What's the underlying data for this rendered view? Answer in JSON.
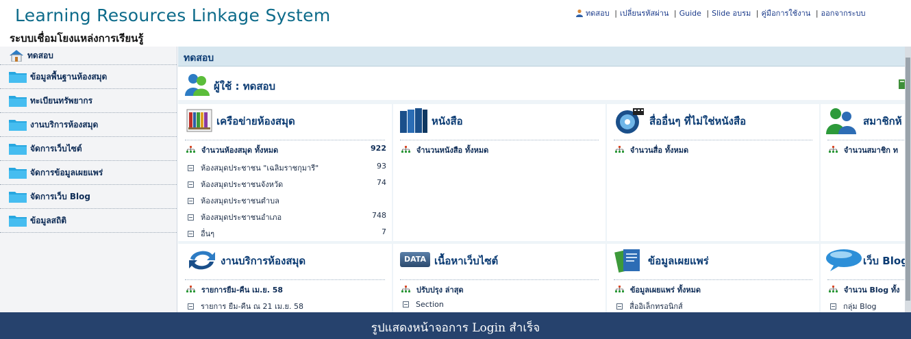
{
  "header": {
    "title": "Learning Resources Linkage System",
    "subtitle": "ระบบเชื่อมโยงแหล่งการเรียนรู้",
    "links": {
      "user": "ทดสอบ",
      "change_password": "เปลี่ยนรหัสผ่าน",
      "guide": "Guide",
      "slide": "Slide อบรม",
      "manual": "คู่มือการใช้งาน",
      "logout": "ออกจากระบบ"
    }
  },
  "sidebar": {
    "items": [
      {
        "label": "ทดสอบ",
        "icon": "home-icon"
      },
      {
        "label": "ข้อมูลพื้นฐานห้องสมุด",
        "icon": "folder-icon"
      },
      {
        "label": "ทะเบียนทรัพยากร",
        "icon": "folder-icon"
      },
      {
        "label": "งานบริการห้องสมุด",
        "icon": "folder-icon"
      },
      {
        "label": "จัดการเว็บไซต์",
        "icon": "folder-icon"
      },
      {
        "label": "จัดการข้อมูลเผยแพร่",
        "icon": "folder-icon"
      },
      {
        "label": "จัดการเว็บ Blog",
        "icon": "folder-icon"
      },
      {
        "label": "ข้อมูลสถิติ",
        "icon": "folder-icon"
      }
    ]
  },
  "main": {
    "title": "ทดสอบ",
    "user_label": "ผู้ใช้ : ทดสอบ",
    "panels": {
      "library": {
        "title": "เครือข่ายห้องสมุด",
        "total_label": "จำนวนห้องสมุด ทั้งหมด",
        "total_value": "922",
        "rows": [
          {
            "label": "ห้องสมุดประชาชน \"เฉลิมราชกุมารี\"",
            "value": "93"
          },
          {
            "label": "ห้องสมุดประชาชนจังหวัด",
            "value": "74"
          },
          {
            "label": "ห้องสมุดประชาชนตำบล",
            "value": ""
          },
          {
            "label": "ห้องสมุดประชาชนอำเภอ",
            "value": "748"
          },
          {
            "label": "อื่นๆ",
            "value": "7"
          }
        ]
      },
      "books": {
        "title": "หนังสือ",
        "total_label": "จำนวนหนังสือ ทั้งหมด"
      },
      "media": {
        "title": "สื่ออื่นๆ ที่ไม่ใช่หนังสือ",
        "total_label": "จำนวนสื่อ ทั้งหมด"
      },
      "members": {
        "title": "สมาชิกห้",
        "total_label": "จำนวนสมาชิก ท"
      },
      "services": {
        "title": "งานบริการห้องสมุด",
        "total_label": "รายการยืม-คืน เม.ย. 58",
        "rows": [
          {
            "label": "รายการ ยืม-คืน ณ 21 เม.ย. 58"
          }
        ]
      },
      "website": {
        "title": "เนื้อหาเว็บไซต์",
        "badge": "DATA",
        "total_label": "ปรับปรุง ล่าสุด",
        "rows": [
          {
            "label": "Section"
          }
        ]
      },
      "publish": {
        "title": "ข้อมูลเผยแพร่",
        "total_label": "ข้อมูลเผยแพร่ ทั้งหมด",
        "rows": [
          {
            "label": "สื่ออิเล็กทรอนิกส์"
          }
        ]
      },
      "blog": {
        "title": "เว็บ Blog",
        "total_label": "จำนวน Blog ทั้ง",
        "rows": [
          {
            "label": "กลุ่ม Blog"
          }
        ]
      }
    }
  },
  "caption": "รูปแสดงหน้าจอการ Login สำเร็จ",
  "colors": {
    "accent": "#0b3b73",
    "caption_bg": "#26426d",
    "panel_bg": "#eef4f8"
  }
}
